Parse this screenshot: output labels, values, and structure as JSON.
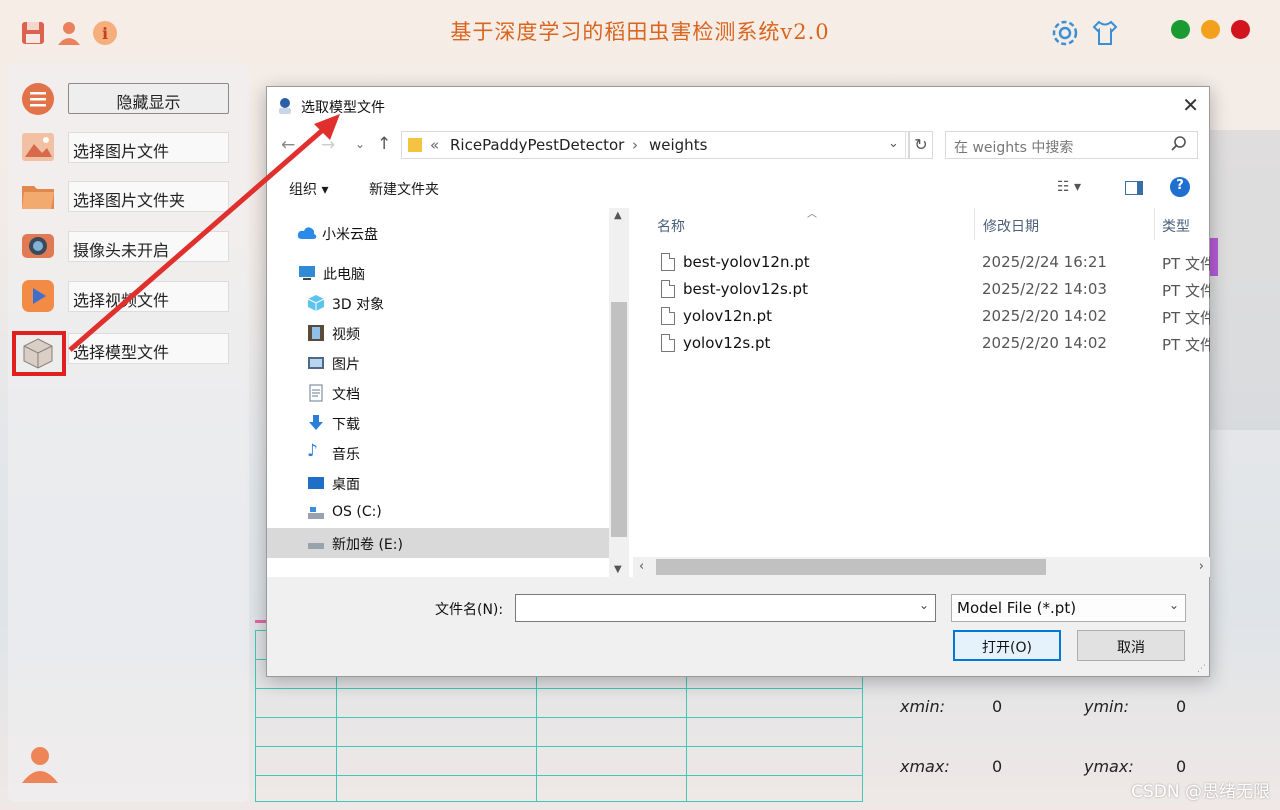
{
  "app": {
    "title": "基于深度学习的稻田虫害检测系统v2.0",
    "window_buttons": [
      "#1a9a31",
      "#f3a11c",
      "#d1141e"
    ]
  },
  "left_panel": {
    "items": [
      {
        "label": "隐藏显示",
        "icon": "menu-icon"
      },
      {
        "label": "选择图片文件",
        "icon": "image-icon"
      },
      {
        "label": "选择图片文件夹",
        "icon": "folder-icon"
      },
      {
        "label": "摄像头未开启",
        "icon": "camera-icon"
      },
      {
        "label": "选择视频文件",
        "icon": "video-icon"
      },
      {
        "label": "选择模型文件",
        "icon": "model-box-icon"
      }
    ]
  },
  "coords": {
    "xmin_label": "xmin:",
    "xmin": "0",
    "ymin_label": "ymin:",
    "ymin": "0",
    "xmax_label": "xmax:",
    "xmax": "0",
    "ymax_label": "ymax:",
    "ymax": "0"
  },
  "watermark": "CSDN @思绪无限",
  "dialog": {
    "title": "选取模型文件",
    "breadcrumb": [
      "«",
      "RicePaddyPestDetector",
      "weights"
    ],
    "search_placeholder": "在 weights 中搜索",
    "organize": "组织 ▾",
    "new_folder": "新建文件夹",
    "tree": [
      {
        "label": "小米云盘",
        "icon": "cloud-icon"
      },
      {
        "label": "此电脑",
        "icon": "computer-icon"
      },
      {
        "label": "3D 对象",
        "icon": "cube-3d-icon"
      },
      {
        "label": "视频",
        "icon": "film-icon"
      },
      {
        "label": "图片",
        "icon": "picture-icon"
      },
      {
        "label": "文档",
        "icon": "document-icon"
      },
      {
        "label": "下载",
        "icon": "download-icon"
      },
      {
        "label": "音乐",
        "icon": "music-icon"
      },
      {
        "label": "桌面",
        "icon": "desktop-icon"
      },
      {
        "label": "OS (C:)",
        "icon": "drive-icon"
      },
      {
        "label": "新加卷 (E:)",
        "icon": "drive-icon"
      }
    ],
    "columns": {
      "name": "名称",
      "date": "修改日期",
      "type": "类型"
    },
    "files": [
      {
        "name": "best-yolov12n.pt",
        "date": "2025/2/24 16:21",
        "type": "PT 文件"
      },
      {
        "name": "best-yolov12s.pt",
        "date": "2025/2/22 14:03",
        "type": "PT 文件"
      },
      {
        "name": "yolov12n.pt",
        "date": "2025/2/20 14:02",
        "type": "PT 文件"
      },
      {
        "name": "yolov12s.pt",
        "date": "2025/2/20 14:02",
        "type": "PT 文件"
      }
    ],
    "filename_label": "文件名(N):",
    "filename_value": "",
    "filetype": "Model File (*.pt)",
    "open": "打开(O)",
    "cancel": "取消"
  }
}
